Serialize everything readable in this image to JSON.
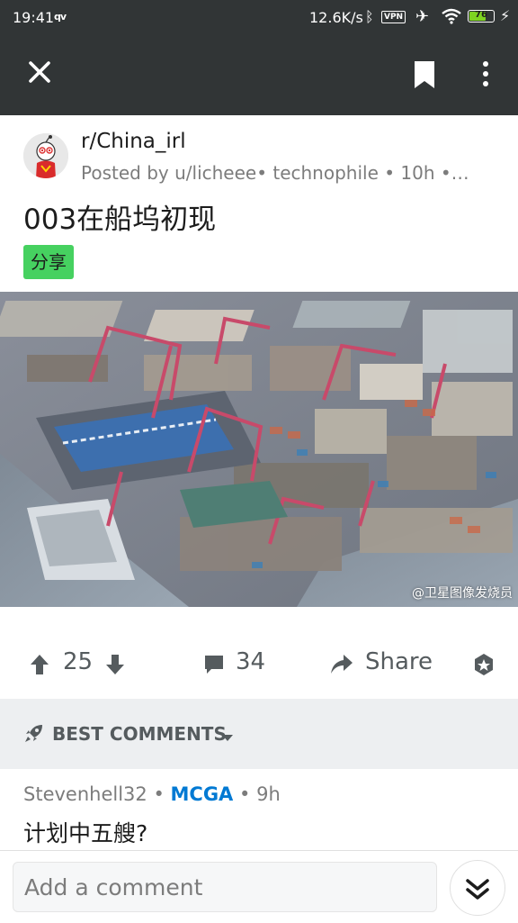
{
  "status_bar": {
    "time": "19:41",
    "app_indicator": "qv",
    "network_rate": "12.6K/s",
    "vpn_label": "VPN",
    "battery_level": "76",
    "battery_fraction": 0.76,
    "icons": [
      "bluetooth-icon",
      "airplane-icon",
      "wifi-icon",
      "battery-icon",
      "charging-icon"
    ]
  },
  "toolbar": {
    "icons": [
      "close-icon",
      "bookmark-icon",
      "more-vertical-icon"
    ],
    "background_color": "#313536"
  },
  "post": {
    "subreddit": "r/China_irl",
    "meta": "Posted by u/licheee• technophile • 10h •…",
    "title": "003在船坞初现",
    "flair": "分享",
    "flair_color": "#46d160",
    "image_watermark": "@卫星图像发烧员"
  },
  "actions": {
    "vote_count": "25",
    "comment_count": "34",
    "share_label": "Share",
    "icons": [
      "upvote-icon",
      "downvote-icon",
      "comment-icon",
      "share-icon",
      "award-icon"
    ]
  },
  "sort": {
    "label": "BEST COMMENTS",
    "icon": "rocket-icon"
  },
  "comments": [
    {
      "author": "Stevenhell32",
      "flair": "MCGA",
      "age": "9h",
      "body": "计划中五艘?"
    }
  ],
  "comment_input": {
    "placeholder": "Add a comment"
  }
}
